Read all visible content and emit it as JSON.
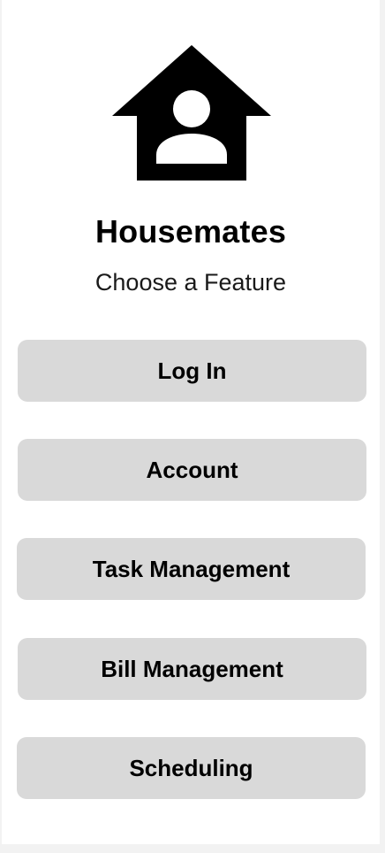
{
  "app": {
    "title": "Housemates",
    "subtitle": "Choose a Feature",
    "logo_icon": "house-person-icon"
  },
  "features": [
    {
      "label": "Log In"
    },
    {
      "label": "Account"
    },
    {
      "label": "Task Management"
    },
    {
      "label": "Bill Management"
    },
    {
      "label": "Scheduling"
    }
  ],
  "colors": {
    "background": "#ffffff",
    "button_background": "#d9d9d9",
    "text": "#000000"
  }
}
